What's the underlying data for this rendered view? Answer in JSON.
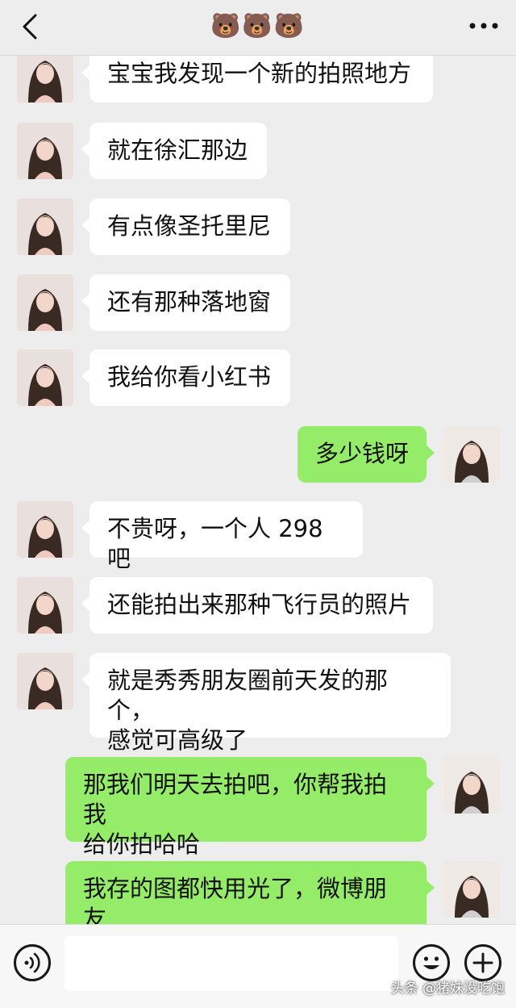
{
  "header": {
    "title": "🐻🐻🐻"
  },
  "messages": [
    {
      "side": "in",
      "text": "宝宝我发现一个新的拍照地方"
    },
    {
      "side": "in",
      "text": "就在徐汇那边"
    },
    {
      "side": "in",
      "text": "有点像圣托里尼"
    },
    {
      "side": "in",
      "text": "还有那种落地窗"
    },
    {
      "side": "in",
      "text": "我给你看小红书"
    },
    {
      "side": "out",
      "text": "多少钱呀"
    },
    {
      "side": "in",
      "text": "不贵呀，一个人 298吧"
    },
    {
      "side": "in",
      "text": "还能拍出来那种飞行员的照片"
    },
    {
      "side": "in",
      "text": "就是秀秀朋友圈前天发的那个，\n感觉可高级了"
    },
    {
      "side": "out",
      "text": "那我们明天去拍吧，你帮我拍我\n给你拍哈哈"
    },
    {
      "side": "out",
      "text": "我存的图都快用光了，微博朋友\n圈不知道发啥了"
    }
  ],
  "watermark": "头条 @猪妹没吃饱",
  "colors": {
    "background": "#ededed",
    "incoming_bubble": "#ffffff",
    "outgoing_bubble": "#95ec69"
  }
}
